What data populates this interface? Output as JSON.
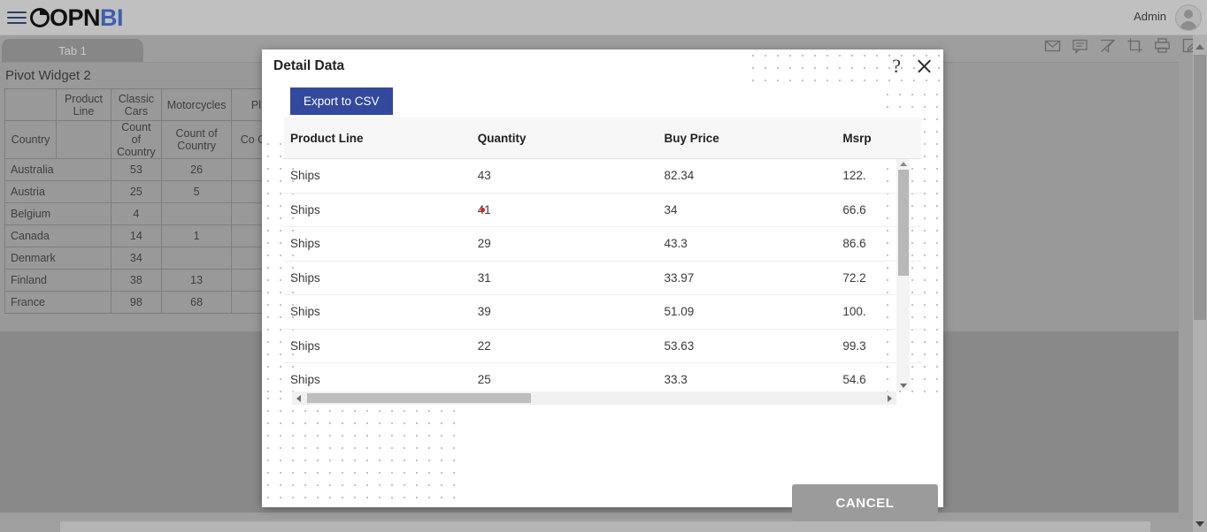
{
  "app": {
    "brand_dark": "OPN",
    "brand_blue": "BI",
    "brand_accent": "#3b5fb0",
    "user_label": "Admin",
    "menu_icon": "hamburger-icon",
    "avatar_icon": "user-avatar-icon"
  },
  "toolbar": {
    "icons": [
      {
        "name": "mail-icon",
        "title": "Mail"
      },
      {
        "name": "comment-icon",
        "title": "Comment"
      },
      {
        "name": "filter-clear-icon",
        "title": "Clear Filter"
      },
      {
        "name": "crop-icon",
        "title": "Crop"
      },
      {
        "name": "print-icon",
        "title": "Print"
      },
      {
        "name": "edit-icon",
        "title": "Edit"
      }
    ]
  },
  "tabs": [
    {
      "label": "Tab 1",
      "active": true
    }
  ],
  "widget": {
    "title": "Pivot Widget 2",
    "pivot": {
      "header_row_1": [
        "",
        "Product Line",
        "Classic Cars",
        "Motorcycles",
        "Pl"
      ],
      "header_row_2": [
        "Country",
        "",
        "Count of Country",
        "Count of Country",
        "Co Co"
      ],
      "rows": [
        {
          "country": "Australia",
          "classic_cars": "53",
          "motorcycles": "26",
          "planes": ""
        },
        {
          "country": "Austria",
          "classic_cars": "25",
          "motorcycles": "5",
          "planes": ""
        },
        {
          "country": "Belgium",
          "classic_cars": "4",
          "motorcycles": "",
          "planes": ""
        },
        {
          "country": "Canada",
          "classic_cars": "14",
          "motorcycles": "1",
          "planes": ""
        },
        {
          "country": "Denmark",
          "classic_cars": "34",
          "motorcycles": "",
          "planes": ""
        },
        {
          "country": "Finland",
          "classic_cars": "38",
          "motorcycles": "13",
          "planes": ""
        },
        {
          "country": "France",
          "classic_cars": "98",
          "motorcycles": "68",
          "planes": ""
        }
      ]
    }
  },
  "modal": {
    "title": "Detail Data",
    "help_icon": "question-mark-icon",
    "close_icon": "close-icon",
    "export_label": "Export to CSV",
    "export_color": "#32499e",
    "cancel_label": "CANCEL",
    "columns": [
      "Product Line",
      "Quantity",
      "Buy Price",
      "Msrp"
    ],
    "rows": [
      {
        "product_line": "Ships",
        "quantity": "43",
        "buy_price": "82.34",
        "msrp": "122."
      },
      {
        "product_line": "Ships",
        "quantity": "41",
        "buy_price": "34",
        "msrp": "66.6"
      },
      {
        "product_line": "Ships",
        "quantity": "29",
        "buy_price": "43.3",
        "msrp": "86.6"
      },
      {
        "product_line": "Ships",
        "quantity": "31",
        "buy_price": "33.97",
        "msrp": "72.2"
      },
      {
        "product_line": "Ships",
        "quantity": "39",
        "buy_price": "51.09",
        "msrp": "100."
      },
      {
        "product_line": "Ships",
        "quantity": "22",
        "buy_price": "53.63",
        "msrp": "99.3"
      },
      {
        "product_line": "Ships",
        "quantity": "25",
        "buy_price": "33.3",
        "msrp": "54.6"
      }
    ]
  }
}
